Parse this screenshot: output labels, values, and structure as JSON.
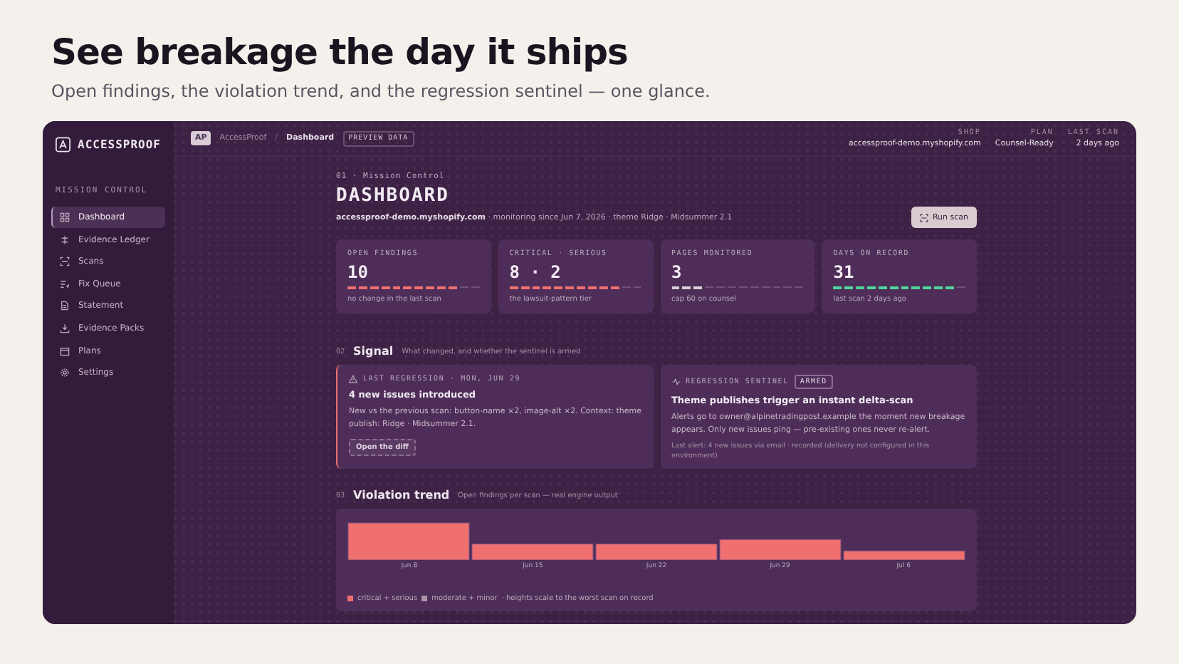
{
  "headline": "See breakage the day it ships",
  "subheadline": "Open findings, the violation trend, and the regression sentinel — one glance.",
  "app": {
    "brand": "ACCESSPROOF",
    "sidebar": {
      "section": "MISSION CONTROL",
      "items": [
        {
          "label": "Dashboard",
          "selected": true
        },
        {
          "label": "Evidence Ledger",
          "selected": false
        },
        {
          "label": "Scans",
          "selected": false
        },
        {
          "label": "Fix Queue",
          "selected": false
        },
        {
          "label": "Statement",
          "selected": false
        },
        {
          "label": "Evidence Packs",
          "selected": false
        },
        {
          "label": "Plans",
          "selected": false
        },
        {
          "label": "Settings",
          "selected": false
        }
      ]
    },
    "topbar": {
      "avatar": "AP",
      "breadcrumb": [
        "AccessProof",
        "Dashboard"
      ],
      "separator": "/",
      "badge": "PREVIEW DATA",
      "meta": [
        {
          "label": "SHOP",
          "value": "accessproof-demo.myshopify.com"
        },
        {
          "label": "PLAN",
          "value": "Counsel-Ready"
        },
        {
          "label": "LAST SCAN",
          "value": "2 days ago"
        }
      ]
    },
    "page": {
      "eyebrow": "01 · Mission Control",
      "title": "DASHBOARD",
      "shop": "accessproof-demo.myshopify.com",
      "details": " · monitoring since Jun 7, 2026 · theme Ridge · Midsummer 2.1",
      "run_button": "Run scan"
    },
    "stats": [
      {
        "label": "OPEN FINDINGS",
        "value": "10",
        "level": 0.83,
        "color": "#f07070",
        "note": "no change in the last scan"
      },
      {
        "label": "CRITICAL · SERIOUS",
        "value": "8 · 2",
        "level": 0.83,
        "color": "#f07070",
        "note": "the lawsuit-pattern tier"
      },
      {
        "label": "PAGES MONITORED",
        "value": "3",
        "level": 0.25,
        "color": "#d8cfd8",
        "note": "cap 60 on counsel"
      },
      {
        "label": "DAYS ON RECORD",
        "value": "31",
        "level": 0.92,
        "color": "#4fd69a",
        "note": "last scan 2 days ago"
      }
    ],
    "signal": {
      "number": "02",
      "title": "Signal",
      "hint": "What changed, and whether the sentinel is armed",
      "regression": {
        "label": "LAST REGRESSION",
        "date": " · MON, JUN 29",
        "title": "4 new issues introduced",
        "body": "New vs the previous scan: button-name ×2, image-alt ×2. Context: theme publish: Ridge · Midsummer 2.1.",
        "button": "Open the diff"
      },
      "sentinel": {
        "label": "REGRESSION SENTINEL",
        "badge": "ARMED",
        "title": "Theme publishes trigger an instant delta-scan",
        "body": "Alerts go to owner@alpinetradingpost.example the moment new breakage appears. Only new issues ping — pre-existing ones never re-alert.",
        "footer": "Last alert: 4 new issues via email · recorded (delivery not configured in this environment)"
      }
    },
    "trend": {
      "number": "03",
      "title": "Violation trend",
      "hint": "Open findings per scan — real engine output",
      "labels": [
        "Jun 8",
        "Jun 15",
        "Jun 22",
        "Jun 29",
        "Jul 6"
      ],
      "legend": [
        {
          "label": "critical + serious",
          "color": "#f07070"
        },
        {
          "label": "moderate + minor",
          "color": "#a996a8"
        }
      ],
      "legend_note": "· heights scale to the worst scan on record"
    }
  }
}
